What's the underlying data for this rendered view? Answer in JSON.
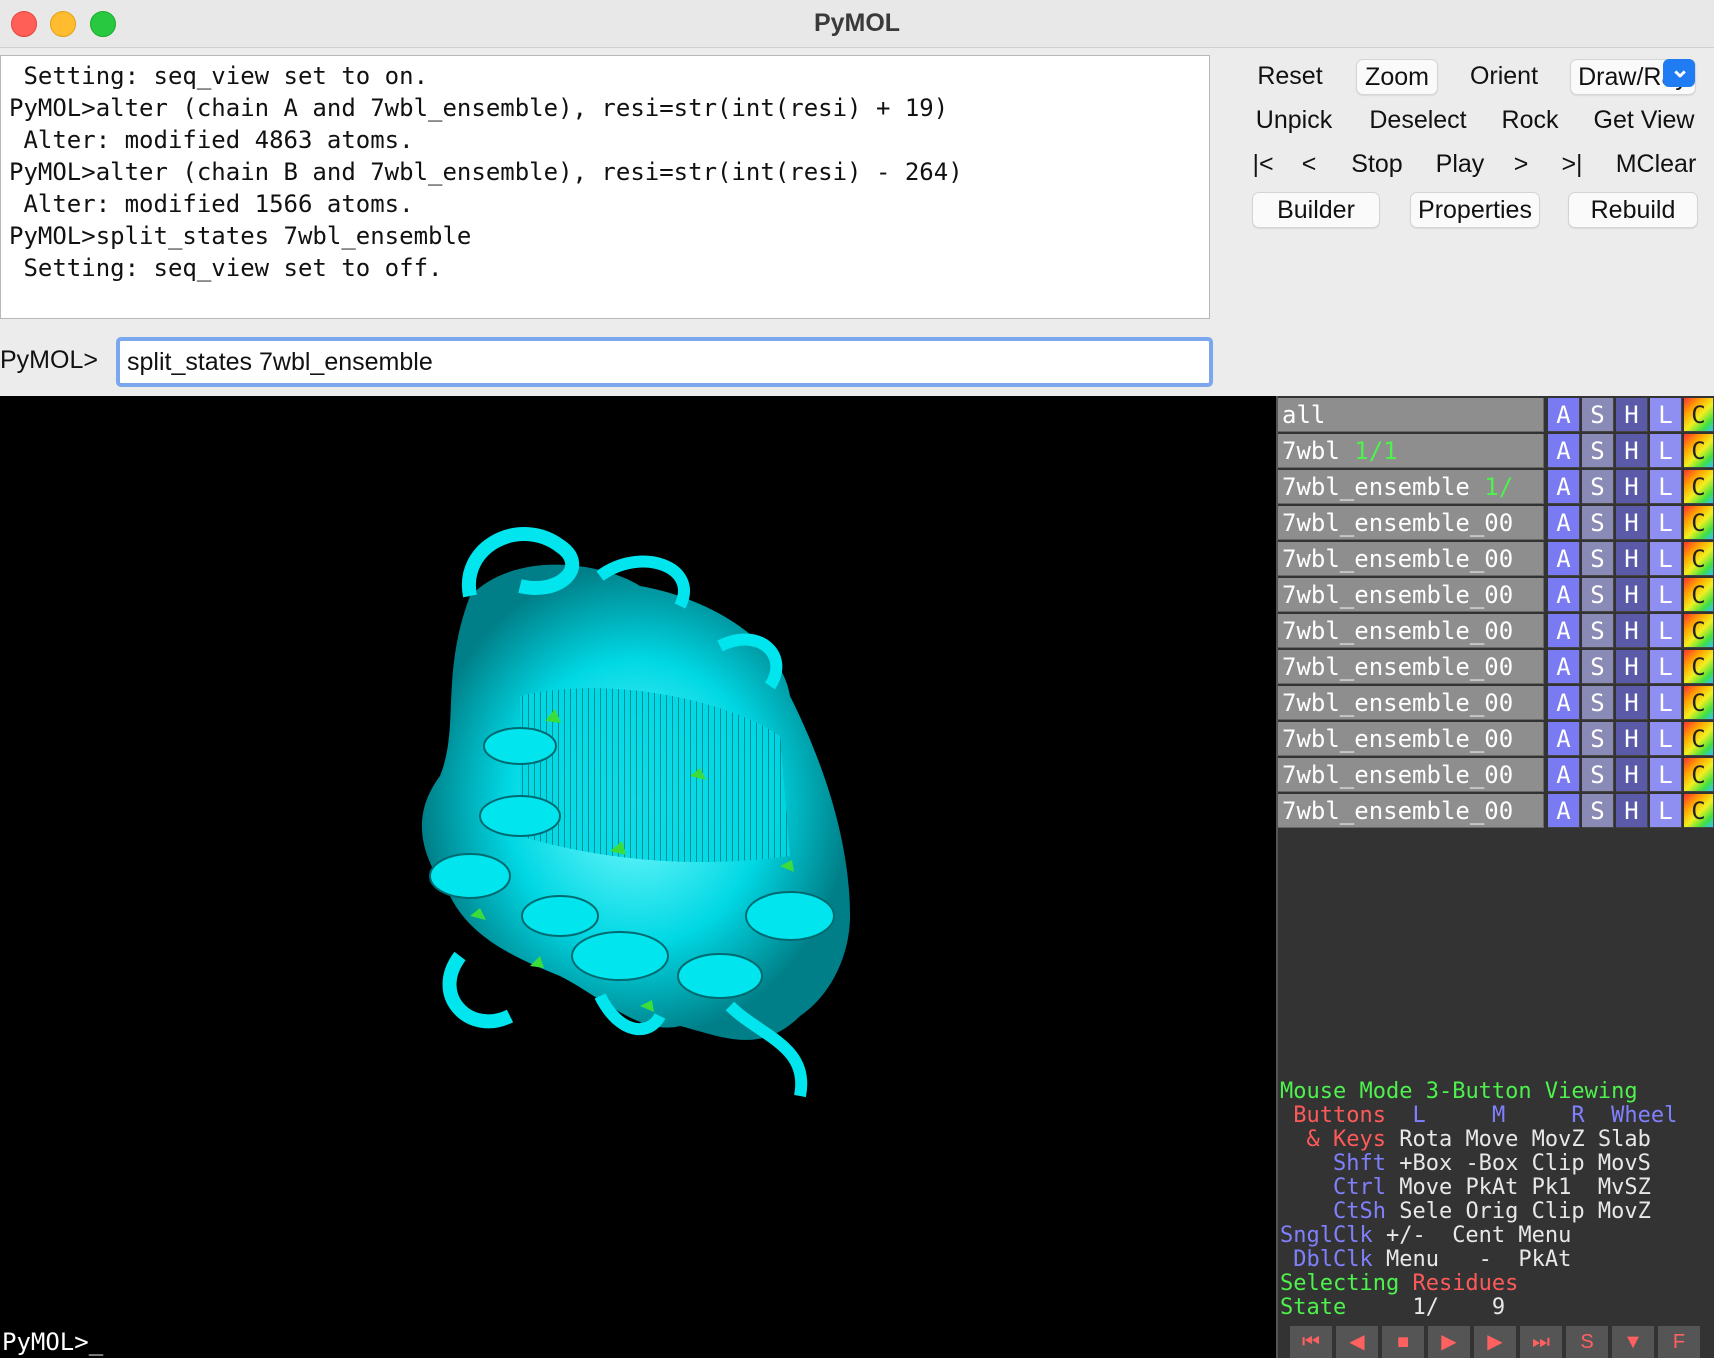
{
  "window": {
    "title": "PyMOL"
  },
  "console": {
    "lines": [
      " Setting: seq_view set to on.",
      "PyMOL>alter (chain A and 7wbl_ensemble), resi=str(int(resi) + 19)",
      " Alter: modified 4863 atoms.",
      "PyMOL>alter (chain B and 7wbl_ensemble), resi=str(int(resi) - 264)",
      " Alter: modified 1566 atoms.",
      "PyMOL>split_states 7wbl_ensemble",
      " Setting: seq_view set to off."
    ]
  },
  "command": {
    "label": "PyMOL>",
    "value": "split_states 7wbl_ensemble"
  },
  "buttons": {
    "reset": "Reset",
    "zoom": "Zoom",
    "orient": "Orient",
    "draw_ray": "Draw/Ray",
    "unpick": "Unpick",
    "deselect": "Deselect",
    "rock": "Rock",
    "get_view": "Get View",
    "first": "|<",
    "prev": "<",
    "stop": "Stop",
    "play": "Play",
    "next": ">",
    "last": ">|",
    "mclear": "MClear",
    "builder": "Builder",
    "properties": "Properties",
    "rebuild": "Rebuild"
  },
  "objects": {
    "action_labels": {
      "a": "A",
      "s": "S",
      "h": "H",
      "l": "L",
      "c": "C"
    },
    "rows": [
      {
        "name": "all",
        "state": ""
      },
      {
        "name": "7wbl ",
        "state": "1/1"
      },
      {
        "name": "7wbl_ensemble ",
        "state": "1/"
      },
      {
        "name": "7wbl_ensemble_00",
        "state": ""
      },
      {
        "name": "7wbl_ensemble_00",
        "state": ""
      },
      {
        "name": "7wbl_ensemble_00",
        "state": ""
      },
      {
        "name": "7wbl_ensemble_00",
        "state": ""
      },
      {
        "name": "7wbl_ensemble_00",
        "state": ""
      },
      {
        "name": "7wbl_ensemble_00",
        "state": ""
      },
      {
        "name": "7wbl_ensemble_00",
        "state": ""
      },
      {
        "name": "7wbl_ensemble_00",
        "state": ""
      },
      {
        "name": "7wbl_ensemble_00",
        "state": ""
      }
    ]
  },
  "mouse_mode": {
    "title_a": "Mouse Mode ",
    "title_b": "3-Button Viewing",
    "buttons_label": " Buttons ",
    "col_l": " L",
    "col_m": "     M",
    "col_r": "     R",
    "col_wheel": "  Wheel",
    "keys_amp": "  & ",
    "keys_label": "Keys",
    "keys_vals": " Rota Move MovZ Slab",
    "shft_label": "    Shft",
    "shft_vals": " +Box -Box Clip MovS",
    "ctrl_label": "    Ctrl",
    "ctrl_vals": " Move PkAt Pk1  MvSZ",
    "ctsh_label": "    CtSh",
    "ctsh_vals": " Sele Orig Clip MovZ",
    "sngl_label": "SnglClk",
    "sngl_vals": " +/-  Cent Menu",
    "dbl_label": " DblClk",
    "dbl_vals": " Menu   -  PkAt",
    "selecting_a": "Selecting ",
    "selecting_b": "Residues",
    "state_label": "State",
    "state_vals": "     1/    9"
  },
  "viewer": {
    "prompt": "PyMOL>_"
  },
  "playback": {
    "first": "⏮",
    "prev": "◀",
    "stop": "■",
    "play": "▶",
    "next": "▶",
    "last": "⏭",
    "scene": "S",
    "down": "▼",
    "full": "F"
  },
  "colors": {
    "protein": "#00e5ee",
    "helix_accent": "#3cdc3c",
    "viewer_bg": "#000000",
    "panel_bg": "#333333"
  }
}
